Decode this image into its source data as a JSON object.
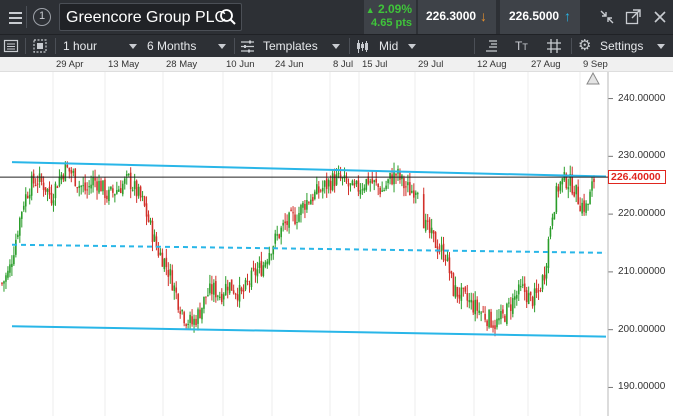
{
  "topbar": {
    "search_value": "Greencore Group PLC",
    "change_percent": "2.09%",
    "change_points": "4.65 pts",
    "sell_price": "226.3000",
    "buy_price": "226.5000",
    "change_color": "#3fc43a",
    "sell_color": "#e8902c",
    "buy_color": "#29b6e8"
  },
  "toolbar": {
    "interval": "1 hour",
    "range": "6 Months",
    "templates_label": "Templates",
    "price_type": "Mid",
    "settings_label": "Settings"
  },
  "chart_data": {
    "type": "candlestick",
    "x_tick_labels": [
      "29 Apr",
      "13 May",
      "28 May",
      "10 Jun",
      "24 Jun",
      "8 Jul",
      "15 Jul",
      "29 Jul",
      "12 Aug",
      "27 Aug",
      "9 Sep"
    ],
    "y_tick_labels": [
      "240.00000",
      "230.00000",
      "220.00000",
      "210.00000",
      "200.00000",
      "190.00000"
    ],
    "ylim": [
      188,
      242
    ],
    "current_price_label": "226.40000",
    "current_price": 226.4,
    "up_color": "#2a9d2a",
    "down_color": "#d2302a",
    "trendline_color": "#29b6e8",
    "channel_upper": [
      229.0,
      226.5
    ],
    "channel_lower": [
      200.6,
      198.8
    ],
    "channel_mid_dashed": [
      214.7,
      213.3
    ],
    "price_path": [
      208,
      210,
      216,
      222,
      225,
      226,
      225,
      223,
      226,
      228,
      227,
      225,
      224,
      226,
      225,
      223,
      224,
      225,
      226,
      224,
      222,
      218,
      214,
      212,
      209,
      205,
      202,
      201,
      203,
      206,
      207,
      206,
      208,
      207,
      206,
      208,
      210,
      211,
      214,
      216,
      218,
      219,
      220,
      222,
      223,
      224,
      225,
      226,
      226,
      225,
      224,
      225,
      226,
      225,
      224,
      226,
      227,
      225,
      224,
      225,
      218,
      216,
      214,
      213,
      207,
      206,
      205,
      204,
      203,
      202,
      201,
      202,
      204,
      206,
      207,
      205,
      206,
      210,
      220,
      225,
      226,
      225,
      222,
      221,
      226
    ]
  }
}
